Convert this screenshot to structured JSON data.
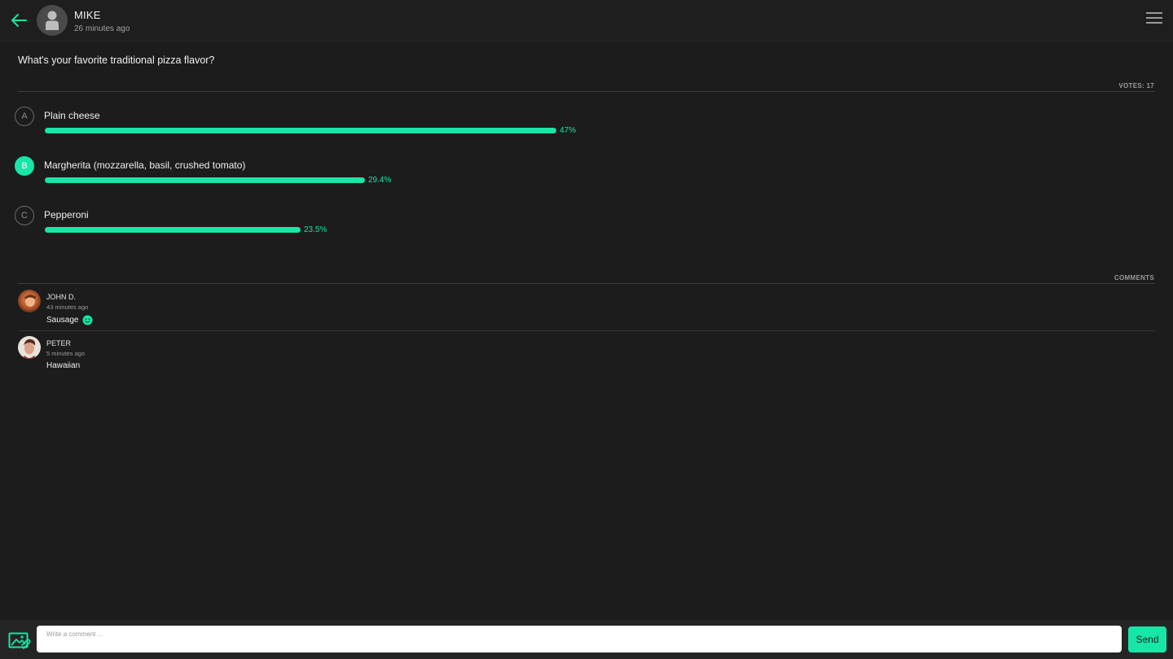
{
  "colors": {
    "accent": "#16e6a6",
    "background": "#1c1c1c",
    "text": "#f0f0f0",
    "muted": "#9a9a9a"
  },
  "header": {
    "back_icon": "arrow-left-icon",
    "author_name": "MIKE",
    "author_time": "26 minutes ago",
    "menu_icon": "hamburger-menu-icon"
  },
  "poll": {
    "question": "What's your favorite traditional pizza flavor?",
    "votes_label": "VOTES: 17",
    "options": [
      {
        "letter": "A",
        "label": "Plain cheese",
        "percent_text": "47%",
        "fraction": 0.47,
        "selected": false
      },
      {
        "letter": "B",
        "label": "Margherita (mozzarella, basil, crushed tomato)",
        "percent_text": "29.4%",
        "fraction": 0.294,
        "selected": true
      },
      {
        "letter": "C",
        "label": "Pepperoni",
        "percent_text": "23.5%",
        "fraction": 0.235,
        "selected": false
      }
    ]
  },
  "comments": {
    "label": "COMMENTS",
    "items": [
      {
        "name": "JOHN D.",
        "time": "43 minutes ago",
        "text": "Sausage",
        "emoji_icon": "smile-icon"
      },
      {
        "name": "PETER",
        "time": "5 minutes ago",
        "text": "Hawaiian"
      }
    ]
  },
  "footer": {
    "attach_icon": "image-attach-icon",
    "input_placeholder": "Write a comment ...",
    "input_value": "",
    "send_label": "Send"
  }
}
